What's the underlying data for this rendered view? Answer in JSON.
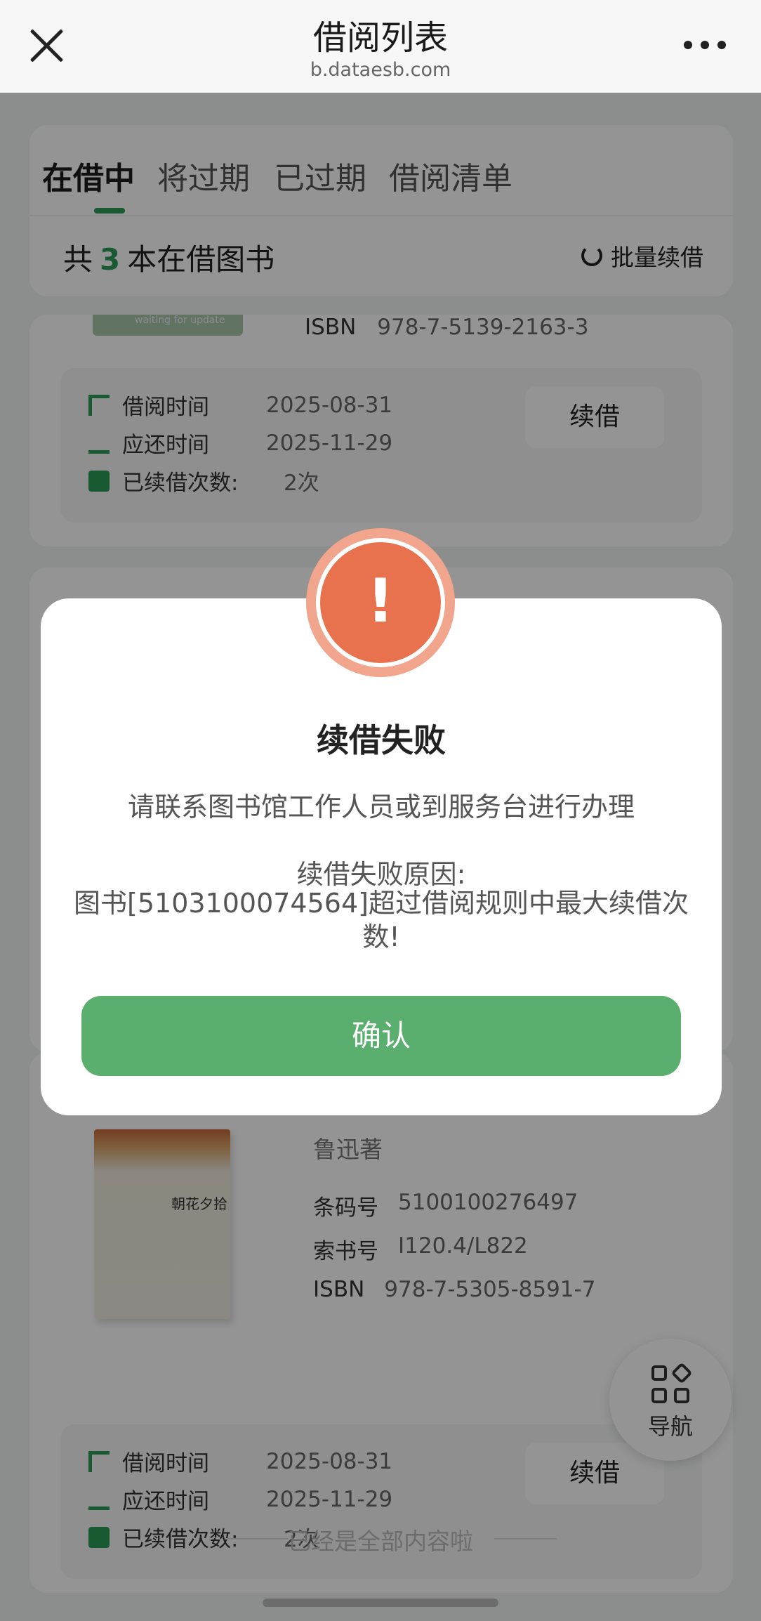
{
  "header": {
    "title": "借阅列表",
    "subtitle": "b.dataesb.com"
  },
  "tabs": [
    {
      "label": "在借中",
      "active": true
    },
    {
      "label": "将过期",
      "active": false
    },
    {
      "label": "已过期",
      "active": false
    },
    {
      "label": "借阅清单",
      "active": false
    }
  ],
  "summary": {
    "prefix": "共",
    "count": "3",
    "suffix": "本在借图书",
    "batch_renew_label": "批量续借"
  },
  "books": [
    {
      "cover_text": "waiting for update",
      "isbn_label": "ISBN",
      "isbn": "978-7-5139-2163-3",
      "borrow_label": "借阅时间",
      "borrow_date": "2025-08-31",
      "due_label": "应还时间",
      "due_date": "2025-11-29",
      "renew_count_label": "已续借次数:",
      "renew_count": "2次",
      "renew_button": "续借"
    },
    {
      "cover_text": "朝花夕拾",
      "author": "鲁迅著",
      "barcode_label": "条码号",
      "barcode": "5100100276497",
      "callno_label": "索书号",
      "callno": "I120.4/L822",
      "isbn_label": "ISBN",
      "isbn": "978-7-5305-8591-7",
      "borrow_label": "借阅时间",
      "borrow_date": "2025-08-31",
      "due_label": "应还时间",
      "due_date": "2025-11-29",
      "renew_count_label": "已续借次数:",
      "renew_count": "2次",
      "renew_button": "续借"
    }
  ],
  "footer": {
    "end_text": "已经是全部内容啦",
    "nav_label": "导航"
  },
  "modal": {
    "icon": "!",
    "title": "续借失败",
    "message": "请联系图书馆工作人员或到服务台进行办理",
    "reason_label": "续借失败原因:",
    "reason": "图书[5103100074564]超过借阅规则中最大续借次数!",
    "confirm_label": "确认"
  },
  "colors": {
    "accent": "#2c9b57",
    "confirm": "#5aaf6f",
    "alert": "#e8714e"
  }
}
